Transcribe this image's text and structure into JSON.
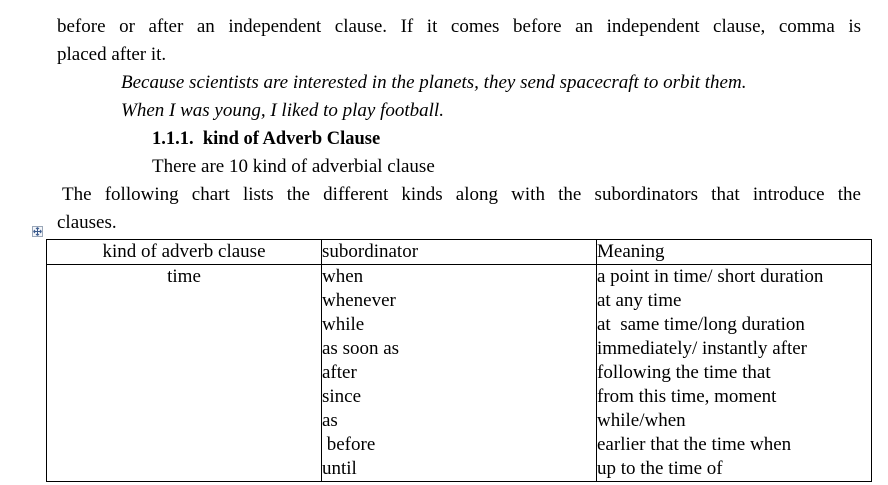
{
  "paragraph_intro": {
    "line1": "before or after an independent clause. If it comes before an independent clause, comma is",
    "line2": "placed after it."
  },
  "examples": [
    "Because scientists are interested in the planets, they send spacecraft to orbit them.",
    "When I was young, I liked to play football."
  ],
  "section": {
    "number": "1.1.1.",
    "title": "kind of Adverb Clause",
    "subtitle": "There are 10 kind of adverbial clause"
  },
  "chart_intro": {
    "line1": "The following chart lists the different kinds along with the subordinators that introduce the",
    "line2": "clauses."
  },
  "table": {
    "headers": [
      "kind of adverb clause",
      "subordinator",
      "Meaning"
    ],
    "kind": "time",
    "subordinators": [
      "when",
      "whenever",
      "while",
      "as soon as",
      "after",
      "since",
      "as",
      " before",
      "until"
    ],
    "meanings": [
      "a point in time/ short duration",
      "at any time",
      "at  same time/long duration",
      "immediately/ instantly after",
      "following the time that",
      "from this time, moment",
      "while/when",
      "earlier that the time when",
      "up to the time of"
    ]
  }
}
